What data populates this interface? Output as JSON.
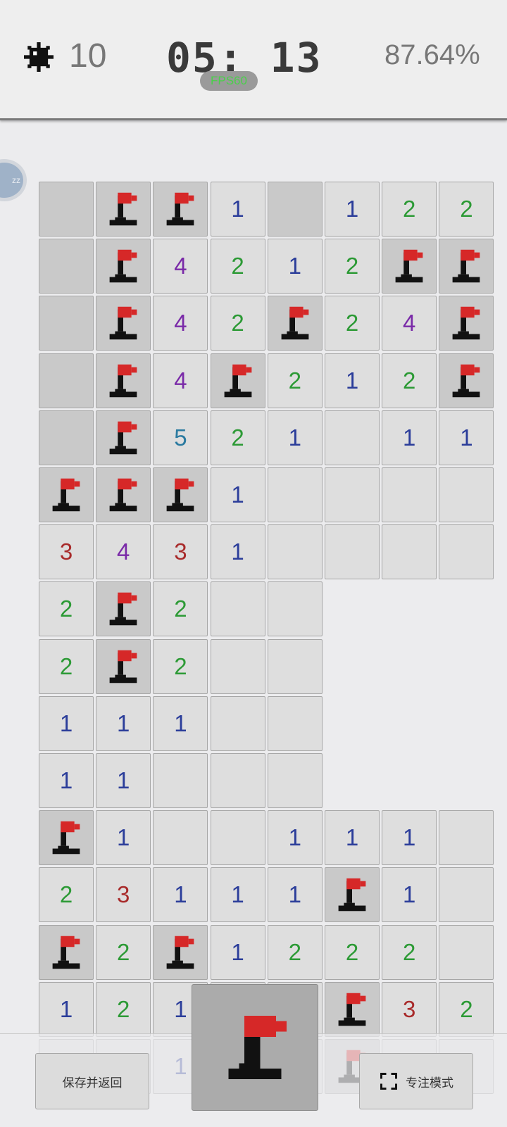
{
  "header": {
    "mine_icon": "mine-icon",
    "mines_remaining": "10",
    "timer": "05: 13",
    "fps": "FPS60",
    "progress_percent": "87.64%"
  },
  "side_avatar_text": "zz",
  "board": {
    "rows": [
      [
        "H",
        "F",
        "F",
        "1",
        "H",
        "1",
        "2",
        "2"
      ],
      [
        "H",
        "F",
        "4",
        "2",
        "1",
        "2",
        "F",
        "F"
      ],
      [
        "H",
        "F",
        "4",
        "2",
        "F",
        "2",
        "4",
        "F"
      ],
      [
        "H",
        "F",
        "4",
        "F",
        "2",
        "1",
        "2",
        "F"
      ],
      [
        "H",
        "F",
        "5",
        "2",
        "1",
        "E",
        "1",
        "1"
      ],
      [
        "F",
        "F",
        "F",
        "1",
        "E",
        "E",
        "E",
        "E"
      ],
      [
        "3",
        "4",
        "3",
        "1",
        "E",
        "E",
        "E",
        "E"
      ],
      [
        "2",
        "F",
        "2",
        "E",
        "E",
        "-",
        "-",
        "-"
      ],
      [
        "2",
        "F",
        "2",
        "E",
        "E",
        "-",
        "-",
        "-"
      ],
      [
        "1",
        "1",
        "1",
        "E",
        "E",
        "-",
        "-",
        "-"
      ],
      [
        "1",
        "1",
        "E",
        "E",
        "E",
        "-",
        "-",
        "-"
      ],
      [
        "F",
        "1",
        "E",
        "E",
        "1",
        "1",
        "1",
        "E"
      ],
      [
        "2",
        "3",
        "1",
        "1",
        "1",
        "F",
        "1",
        "E"
      ],
      [
        "F",
        "2",
        "F",
        "1",
        "2",
        "2",
        "2",
        "E"
      ],
      [
        "1",
        "2",
        "1",
        "E",
        "E",
        "F",
        "3",
        "2"
      ],
      [
        "E",
        "E",
        "1",
        "E",
        "E",
        "F",
        "E",
        "E"
      ]
    ],
    "colors": {
      "flag": "#d62828",
      "base": "#111111"
    }
  },
  "controls": {
    "save_label": "保存并返回",
    "focus_label": "专注模式",
    "flag_tool_icon": "flag-icon"
  }
}
